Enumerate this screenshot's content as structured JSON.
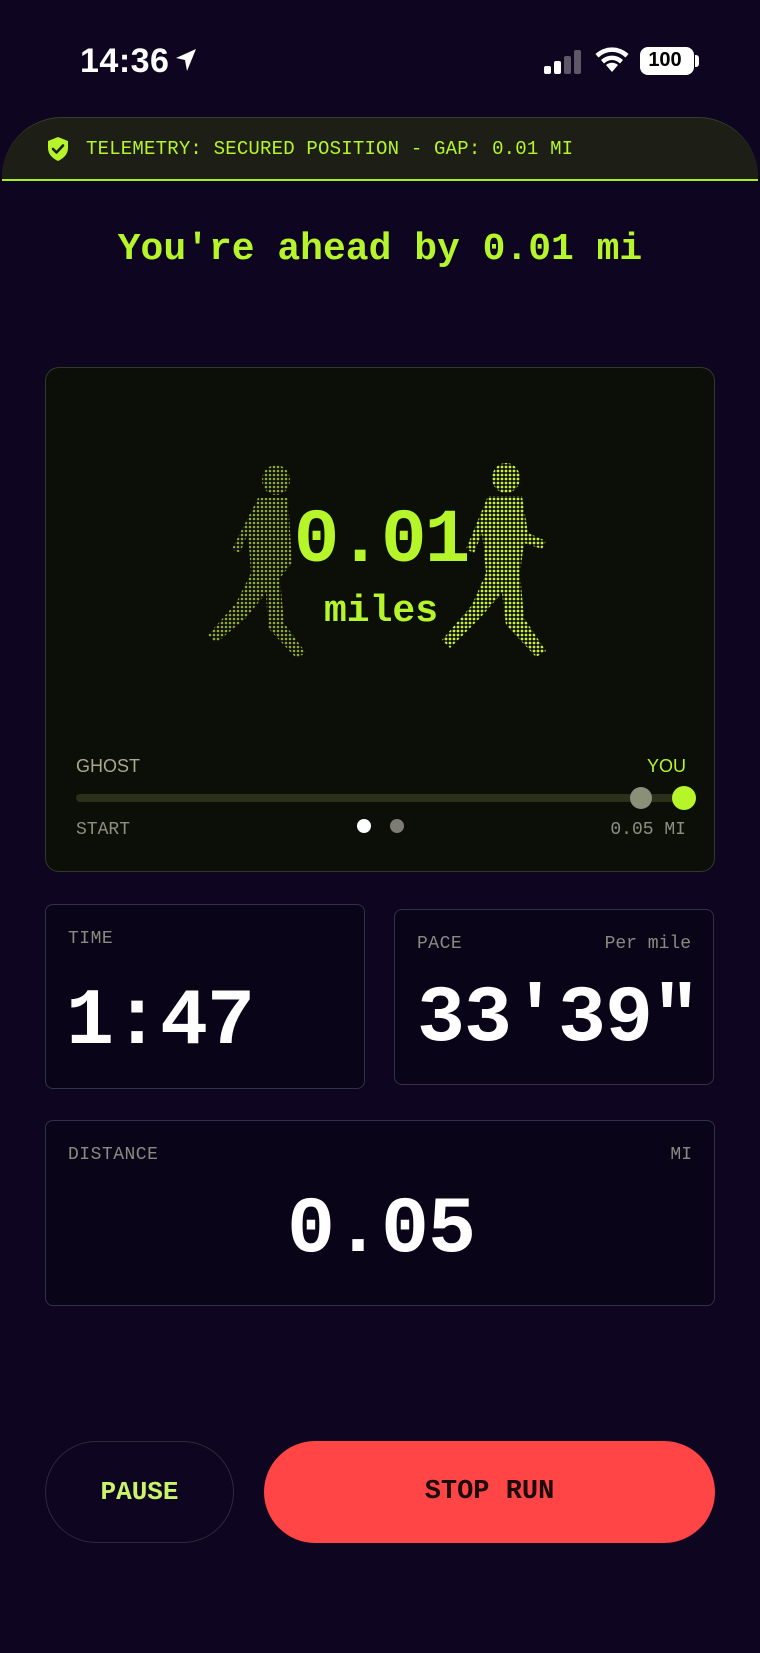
{
  "status_bar": {
    "time": "14:36",
    "battery": "100"
  },
  "telemetry": {
    "text": "TELEMETRY: SECURED POSITION - GAP: 0.01 MI"
  },
  "headline": "You're ahead by 0.01 mi",
  "ghost_card": {
    "gap_value": "0.01",
    "gap_unit": "miles",
    "ghost_label": "GHOST",
    "you_label": "YOU",
    "start_label": "START",
    "end_label": "0.05 MI",
    "pager": {
      "active_index": 0,
      "count": 2
    },
    "progress": {
      "ghost_fraction": 0.93,
      "you_fraction": 1.0
    }
  },
  "stats": {
    "time": {
      "label": "TIME",
      "value": "1:47"
    },
    "pace": {
      "label": "PACE",
      "sub": "Per mile",
      "value": "33'39\""
    },
    "distance": {
      "label": "DISTANCE",
      "unit": "MI",
      "value": "0.05"
    }
  },
  "buttons": {
    "pause": "PAUSE",
    "stop": "STOP RUN"
  },
  "colors": {
    "background": "#0e0520",
    "accent": "#b5f52a",
    "stop": "#ff4545",
    "card": "#0b0f08"
  }
}
